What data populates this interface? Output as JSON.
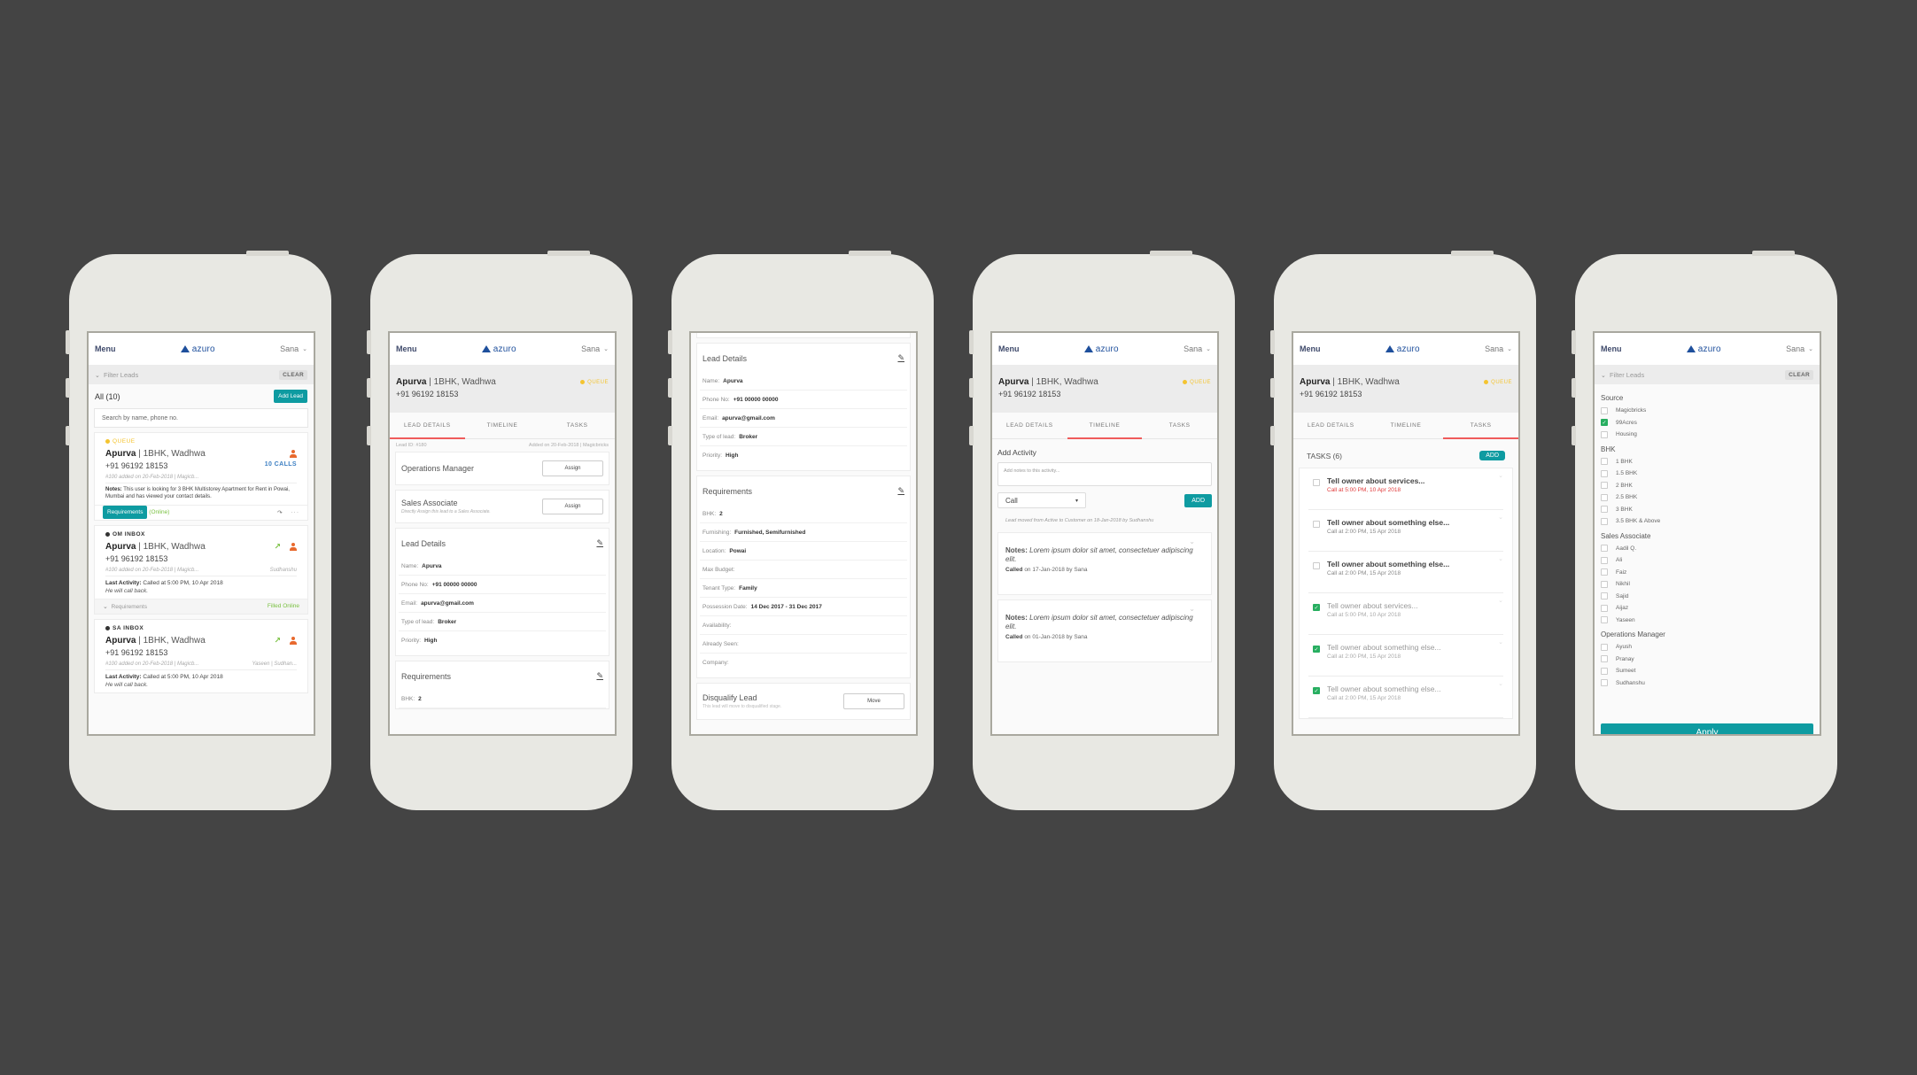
{
  "app": {
    "menu_label": "Menu",
    "brand": "azuro",
    "user": "Sana",
    "brand_color": "#1e4f9c",
    "accent_color": "#0e9ba1",
    "tab_indicator_color": "#ef5b5b"
  },
  "screen1": {
    "filter_label": "Filter Leads",
    "clear_label": "CLEAR",
    "list_title": "All (10)",
    "add_lead_label": "Add Lead",
    "search_placeholder": "Search by name, phone no.",
    "cards": [
      {
        "status": "QUEUE",
        "status_color": "#f4c430",
        "name": "Apurva",
        "detail": " | 1BHK, Wadhwa",
        "phone": "+91 96192 18153",
        "calls": "10 CALLS",
        "meta": "#100 added on 20-Feb-2018 | Magicb...",
        "assignee": "",
        "notes_label": "Notes:",
        "notes": " This user is looking for 3 BHK Multistorey Apartment for Rent in Powai, Mumbai and has viewed your contact details.",
        "foot_button": "Requirements",
        "foot_status": "(Online)"
      },
      {
        "status": "OM INBOX",
        "status_color": "#333333",
        "name": "Apurva",
        "detail": " | 1BHK, Wadhwa",
        "phone": "+91 96192 18153",
        "meta": "#100 added on 20-Feb-2018 | Magicb...",
        "assignee": "Sudhanshu",
        "last_label": "Last Activity:",
        "last": " Called at 5:00 PM, 10 Apr 2018",
        "last_note": "He will call back.",
        "foot_label": "Requirements",
        "foot_status": "Filled Online"
      },
      {
        "status": "SA INBOX",
        "status_color": "#333333",
        "name": "Apurva",
        "detail": " | 1BHK, Wadhwa",
        "phone": "+91 96192 18153",
        "meta": "#100 added on 20-Feb-2018 | Magicb...",
        "assignee": "Yaseen | Sudhan...",
        "last_label": "Last Activity:",
        "last": " Called at 5:00 PM, 10 Apr 2018",
        "last_note": "He will call back."
      }
    ]
  },
  "lead": {
    "name": "Apurva",
    "detail": " | 1BHK, Wadhwa",
    "phone": "+91 96192 18153",
    "status": "QUEUE",
    "tabs": [
      "LEAD DETAILS",
      "TIMELINE",
      "TASKS"
    ]
  },
  "screen2": {
    "lead_id": "Lead ID: #180",
    "added": "Added on 20-Feb-2018 | Magicbricks",
    "om_title": "Operations Manager",
    "assign_label": "Assign",
    "sa_title": "Sales Associate",
    "sa_sub": "Directly Assign this lead to a Sales Associate.",
    "details_title": "Lead Details",
    "details": [
      {
        "k": "Name:",
        "v": "Apurva"
      },
      {
        "k": "Phone No:",
        "v": "+91 00000 00000"
      },
      {
        "k": "Email:",
        "v": "apurva@gmail.com"
      },
      {
        "k": "Type of lead:",
        "v": "Broker"
      },
      {
        "k": "Priority:",
        "v": "High"
      }
    ],
    "req_title": "Requirements",
    "req_first": {
      "k": "BHK:",
      "v": "2"
    }
  },
  "screen3": {
    "details_title": "Lead Details",
    "req_title": "Requirements",
    "requirements": [
      {
        "k": "BHK:",
        "v": "2"
      },
      {
        "k": "Furnishing:",
        "v": "Furnished, Semifurnished"
      },
      {
        "k": "Location:",
        "v": "Powai"
      },
      {
        "k": "Max Budget:",
        "v": ""
      },
      {
        "k": "Tenant Type:",
        "v": "Family"
      },
      {
        "k": "Possession Date:",
        "v": "14 Dec 2017 - 31 Dec 2017"
      },
      {
        "k": "Availability:",
        "v": ""
      },
      {
        "k": "Already Seen:",
        "v": ""
      },
      {
        "k": "Company:",
        "v": ""
      }
    ],
    "disqualify_title": "Disqualify Lead",
    "disqualify_sub": "This lead will move to disqualified stage.",
    "move_label": "Move"
  },
  "screen4": {
    "add_activity": "Add Activity",
    "notes_placeholder": "Add notes to this activity...",
    "activity_type": "Call",
    "add_label": "ADD",
    "log": "Lead moved from Active to Customer on 18-Jan-2018 by Sudhanshu",
    "entries": [
      {
        "notes_label": "Notes:",
        "notes": " Lorem ipsum dolor sit amet, consectetuer adipiscing elit.",
        "action": "Called",
        "when": " on 17-Jan-2018 by Sana"
      },
      {
        "notes_label": "Notes:",
        "notes": " Lorem ipsum dolor sit amet, consectetuer adipiscing elit.",
        "action": "Called",
        "when": " on 01-Jan-2018 by Sana"
      }
    ]
  },
  "screen5": {
    "tasks_title": "TASKS (6)",
    "add_label": "ADD",
    "tasks": [
      {
        "title": "Tell owner about services...",
        "sub": "Call at 5:00 PM, 10 Apr 2018",
        "done": false,
        "overdue": true
      },
      {
        "title": "Tell owner about something else...",
        "sub": "Call at 2:00 PM, 15 Apr 2018",
        "done": false,
        "overdue": false
      },
      {
        "title": "Tell owner about something else...",
        "sub": "Call at 2:00 PM, 15 Apr 2018",
        "done": false,
        "overdue": false
      },
      {
        "title": "Tell owner about services...",
        "sub": "Call at 5:00 PM, 10 Apr 2018",
        "done": true,
        "overdue": false
      },
      {
        "title": "Tell owner about something else...",
        "sub": "Call at 2:00 PM, 15 Apr 2018",
        "done": true,
        "overdue": false
      },
      {
        "title": "Tell owner about something else...",
        "sub": "Call at 2:00 PM, 15 Apr 2018",
        "done": true,
        "overdue": false
      }
    ]
  },
  "screen6": {
    "filter_label": "Filter Leads",
    "clear_label": "CLEAR",
    "groups": [
      {
        "title": "Source",
        "options": [
          {
            "label": "Magicbricks",
            "checked": false
          },
          {
            "label": "99Acres",
            "checked": true
          },
          {
            "label": "Housing",
            "checked": false
          }
        ]
      },
      {
        "title": "BHK",
        "options": [
          {
            "label": "1 BHK",
            "checked": false
          },
          {
            "label": "1.5 BHK",
            "checked": false
          },
          {
            "label": "2 BHK",
            "checked": false
          },
          {
            "label": "2.5 BHK",
            "checked": false
          },
          {
            "label": "3 BHK",
            "checked": false
          },
          {
            "label": "3.5 BHK & Above",
            "checked": false
          }
        ]
      },
      {
        "title": "Sales Associate",
        "options": [
          {
            "label": "Aadil Q.",
            "checked": false
          },
          {
            "label": "Ali",
            "checked": false
          },
          {
            "label": "Faiz",
            "checked": false
          },
          {
            "label": "Nikhil",
            "checked": false
          },
          {
            "label": "Sajid",
            "checked": false
          },
          {
            "label": "Aijaz",
            "checked": false
          },
          {
            "label": "Yaseen",
            "checked": false
          }
        ]
      },
      {
        "title": "Operations Manager",
        "options": [
          {
            "label": "Ayush",
            "checked": false
          },
          {
            "label": "Pranay",
            "checked": false
          },
          {
            "label": "Sumeet",
            "checked": false
          },
          {
            "label": "Sudhanshu",
            "checked": false
          }
        ]
      }
    ],
    "apply_label": "Apply"
  }
}
